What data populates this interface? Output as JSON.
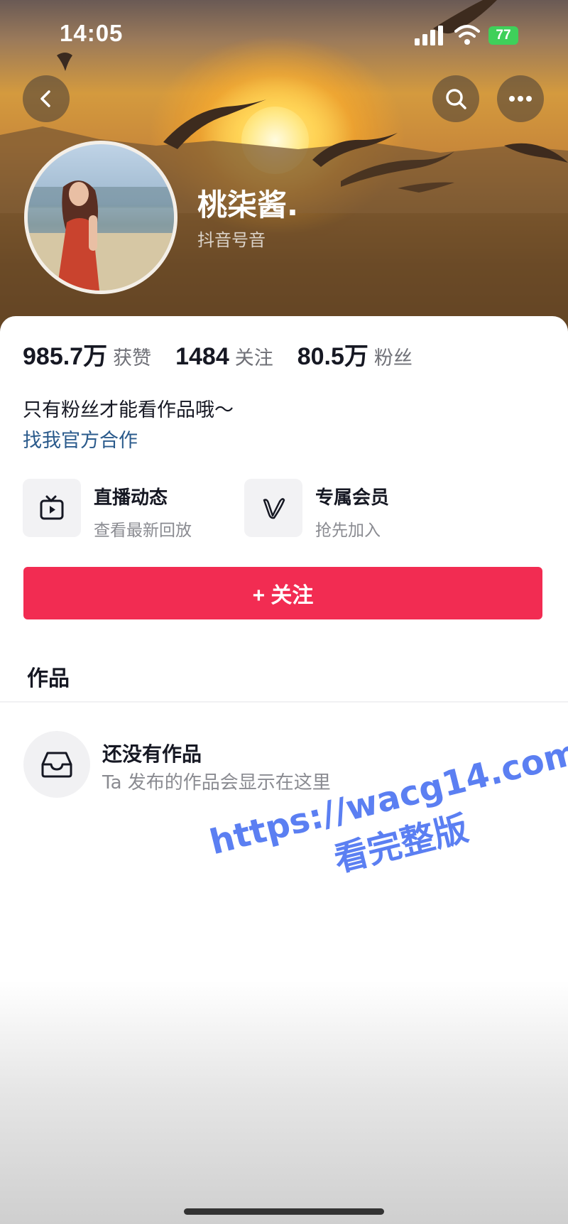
{
  "status_bar": {
    "time": "14:05",
    "battery": "77"
  },
  "profile": {
    "name": "桃柒酱.",
    "sub_label": "抖音号音",
    "stats": [
      {
        "value": "985.7万",
        "label": "获赞"
      },
      {
        "value": "1484",
        "label": "关注"
      },
      {
        "value": "80.5万",
        "label": "粉丝"
      }
    ],
    "bio": "只有粉丝才能看作品哦～",
    "business_link": "找我官方合作"
  },
  "features": [
    {
      "title": "直播动态",
      "subtitle": "查看最新回放",
      "icon": "tv-play-icon"
    },
    {
      "title": "专属会员",
      "subtitle": "抢先加入",
      "icon": "v-member-icon"
    }
  ],
  "follow_button": "+ 关注",
  "works_tab": "作品",
  "empty_state": {
    "title": "还没有作品",
    "subtitle": "Ta 发布的作品会显示在这里"
  },
  "watermark": {
    "url": "https://wacg14.com",
    "text": "看完整版"
  },
  "colors": {
    "follow": "#f22c52",
    "link": "#2b5b8c",
    "watermark": "#5b7ff2"
  }
}
